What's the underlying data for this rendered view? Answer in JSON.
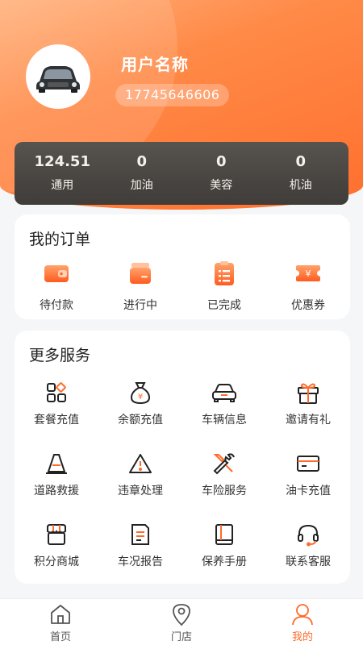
{
  "profile": {
    "username": "用户名称",
    "phone": "17745646606",
    "avatar_icon": "car-avatar"
  },
  "balances": [
    {
      "value": "124.51",
      "label": "通用"
    },
    {
      "value": "0",
      "label": "加油"
    },
    {
      "value": "0",
      "label": "美容"
    },
    {
      "value": "0",
      "label": "机油"
    }
  ],
  "orders": {
    "title": "我的订单",
    "items": [
      {
        "label": "待付款",
        "icon": "wallet-icon"
      },
      {
        "label": "进行中",
        "icon": "box-icon"
      },
      {
        "label": "已完成",
        "icon": "clipboard-icon"
      },
      {
        "label": "优惠券",
        "icon": "coupon-icon"
      }
    ]
  },
  "services": {
    "title": "更多服务",
    "items": [
      {
        "label": "套餐充值",
        "icon": "grid-icon"
      },
      {
        "label": "余额充值",
        "icon": "money-bag-icon"
      },
      {
        "label": "车辆信息",
        "icon": "car-icon"
      },
      {
        "label": "邀请有礼",
        "icon": "gift-icon"
      },
      {
        "label": "道路救援",
        "icon": "traffic-cone-icon"
      },
      {
        "label": "违章处理",
        "icon": "warning-icon"
      },
      {
        "label": "车险服务",
        "icon": "wrench-icon"
      },
      {
        "label": "油卡充值",
        "icon": "card-icon"
      },
      {
        "label": "积分商城",
        "icon": "shop-icon"
      },
      {
        "label": "车况报告",
        "icon": "report-icon"
      },
      {
        "label": "保养手册",
        "icon": "book-icon"
      },
      {
        "label": "联系客服",
        "icon": "headset-icon"
      }
    ]
  },
  "tabs": [
    {
      "label": "首页",
      "icon": "home-icon"
    },
    {
      "label": "门店",
      "icon": "location-icon"
    },
    {
      "label": "我的",
      "icon": "user-icon",
      "active": true
    }
  ],
  "colors": {
    "accent": "#ff6a2a",
    "header_gradient_start": "#ffb07a",
    "header_gradient_end": "#ff6f2e",
    "balance_card": "#4a4643"
  }
}
